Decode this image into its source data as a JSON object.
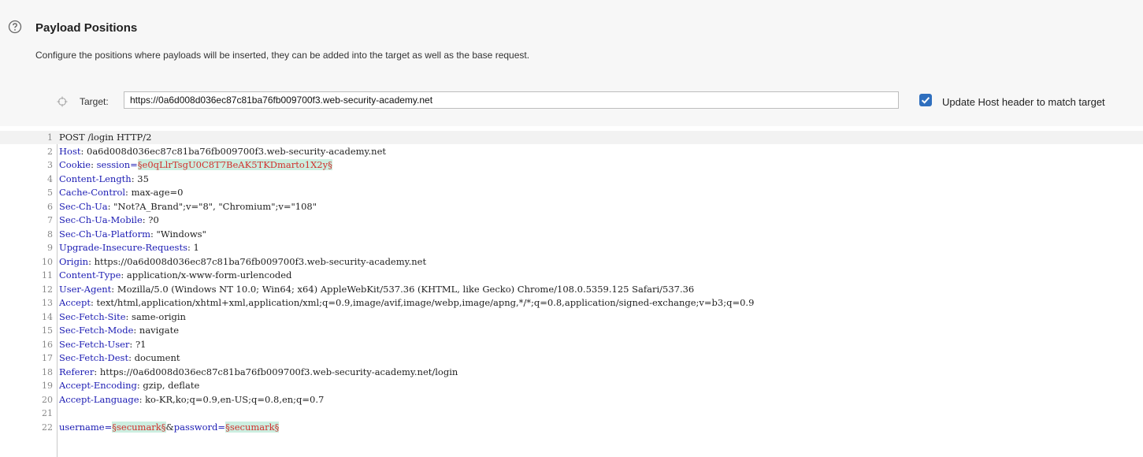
{
  "section": {
    "title": "Payload Positions",
    "description": "Configure the positions where payloads will be inserted, they can be added into the target as well as the base request."
  },
  "target": {
    "label": "Target:",
    "value": "https://0a6d008d036ec87c81ba76fb009700f3.web-security-academy.net"
  },
  "update_host": {
    "label": "Update Host header to match target",
    "checked": true
  },
  "request_lines": [
    {
      "n": "1",
      "parts": [
        {
          "t": "POST /login HTTP/2",
          "c": "plain"
        }
      ]
    },
    {
      "n": "2",
      "parts": [
        {
          "t": "Host",
          "c": "key"
        },
        {
          "t": ": 0a6d008d036ec87c81ba76fb009700f3.web-security-academy.net",
          "c": "plain"
        }
      ]
    },
    {
      "n": "3",
      "parts": [
        {
          "t": "Cookie",
          "c": "key"
        },
        {
          "t": ": ",
          "c": "plain"
        },
        {
          "t": "session=",
          "c": "key"
        },
        {
          "t": "§e0qLlrTsgU0C8T7BeAK5TKDmarto1X2y§",
          "c": "marker"
        }
      ]
    },
    {
      "n": "4",
      "parts": [
        {
          "t": "Content-Length",
          "c": "key"
        },
        {
          "t": ": 35",
          "c": "plain"
        }
      ]
    },
    {
      "n": "5",
      "parts": [
        {
          "t": "Cache-Control",
          "c": "key"
        },
        {
          "t": ": max-age=0",
          "c": "plain"
        }
      ]
    },
    {
      "n": "6",
      "parts": [
        {
          "t": "Sec-Ch-Ua",
          "c": "key"
        },
        {
          "t": ": \"Not?A_Brand\";v=\"8\", \"Chromium\";v=\"108\"",
          "c": "plain"
        }
      ]
    },
    {
      "n": "7",
      "parts": [
        {
          "t": "Sec-Ch-Ua-Mobile",
          "c": "key"
        },
        {
          "t": ": ?0",
          "c": "plain"
        }
      ]
    },
    {
      "n": "8",
      "parts": [
        {
          "t": "Sec-Ch-Ua-Platform",
          "c": "key"
        },
        {
          "t": ": \"Windows\"",
          "c": "plain"
        }
      ]
    },
    {
      "n": "9",
      "parts": [
        {
          "t": "Upgrade-Insecure-Requests",
          "c": "key"
        },
        {
          "t": ": 1",
          "c": "plain"
        }
      ]
    },
    {
      "n": "10",
      "parts": [
        {
          "t": "Origin",
          "c": "key"
        },
        {
          "t": ": https://0a6d008d036ec87c81ba76fb009700f3.web-security-academy.net",
          "c": "plain"
        }
      ]
    },
    {
      "n": "11",
      "parts": [
        {
          "t": "Content-Type",
          "c": "key"
        },
        {
          "t": ": application/x-www-form-urlencoded",
          "c": "plain"
        }
      ]
    },
    {
      "n": "12",
      "parts": [
        {
          "t": "User-Agent",
          "c": "key"
        },
        {
          "t": ": Mozilla/5.0 (Windows NT 10.0; Win64; x64) AppleWebKit/537.36 (KHTML, like Gecko) Chrome/108.0.5359.125 Safari/537.36",
          "c": "plain"
        }
      ]
    },
    {
      "n": "13",
      "parts": [
        {
          "t": "Accept",
          "c": "key"
        },
        {
          "t": ": text/html,application/xhtml+xml,application/xml;q=0.9,image/avif,image/webp,image/apng,*/*;q=0.8,application/signed-exchange;v=b3;q=0.9",
          "c": "plain"
        }
      ]
    },
    {
      "n": "14",
      "parts": [
        {
          "t": "Sec-Fetch-Site",
          "c": "key"
        },
        {
          "t": ": same-origin",
          "c": "plain"
        }
      ]
    },
    {
      "n": "15",
      "parts": [
        {
          "t": "Sec-Fetch-Mode",
          "c": "key"
        },
        {
          "t": ": navigate",
          "c": "plain"
        }
      ]
    },
    {
      "n": "16",
      "parts": [
        {
          "t": "Sec-Fetch-User",
          "c": "key"
        },
        {
          "t": ": ?1",
          "c": "plain"
        }
      ]
    },
    {
      "n": "17",
      "parts": [
        {
          "t": "Sec-Fetch-Dest",
          "c": "key"
        },
        {
          "t": ": document",
          "c": "plain"
        }
      ]
    },
    {
      "n": "18",
      "parts": [
        {
          "t": "Referer",
          "c": "key"
        },
        {
          "t": ": https://0a6d008d036ec87c81ba76fb009700f3.web-security-academy.net/login",
          "c": "plain"
        }
      ]
    },
    {
      "n": "19",
      "parts": [
        {
          "t": "Accept-Encoding",
          "c": "key"
        },
        {
          "t": ": gzip, deflate",
          "c": "plain"
        }
      ]
    },
    {
      "n": "20",
      "parts": [
        {
          "t": "Accept-Language",
          "c": "key"
        },
        {
          "t": ": ko-KR,ko;q=0.9,en-US;q=0.8,en;q=0.7",
          "c": "plain"
        }
      ]
    },
    {
      "n": "21",
      "parts": []
    },
    {
      "n": "22",
      "parts": [
        {
          "t": "username=",
          "c": "key"
        },
        {
          "t": "§secumark§",
          "c": "marker"
        },
        {
          "t": "&",
          "c": "plain"
        },
        {
          "t": "password=",
          "c": "key"
        },
        {
          "t": "§secumark§",
          "c": "marker"
        }
      ]
    }
  ]
}
